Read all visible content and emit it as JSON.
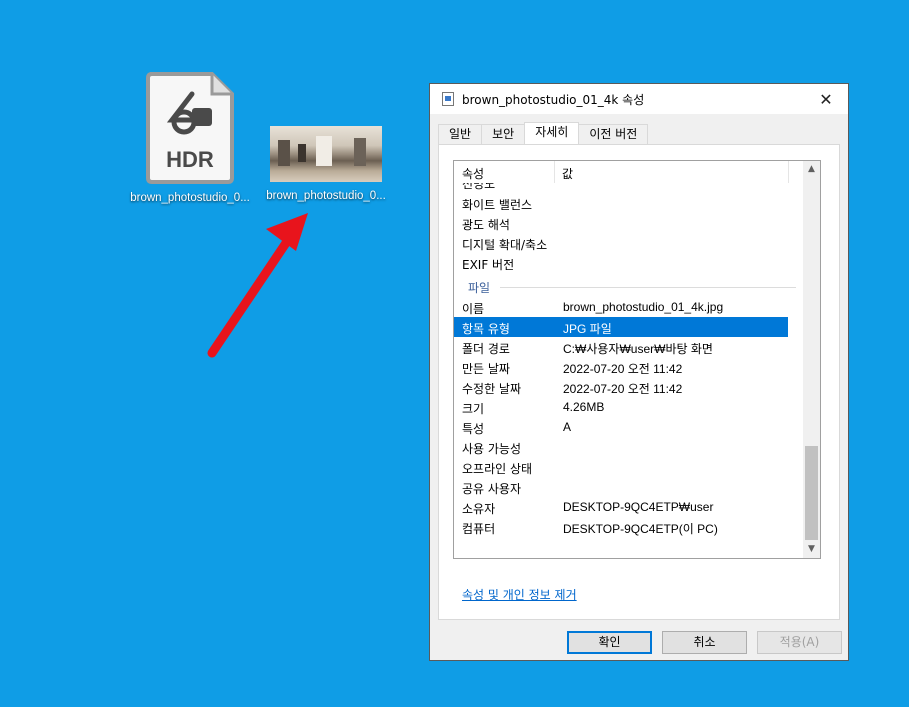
{
  "desktop": {
    "icons": [
      {
        "label": "brown_photostudio_0...",
        "badge": "HDR",
        "icon": "hdr-file-icon"
      },
      {
        "label": "brown_photostudio_0...",
        "icon": "jpg-thumbnail"
      }
    ],
    "accent_color": "#0f9de6",
    "arrow_color": "#e8141c"
  },
  "dialog": {
    "title": "brown_photostudio_01_4k 속성",
    "close_icon": "✕",
    "tabs": [
      "일반",
      "보안",
      "자세히",
      "이전 버전"
    ],
    "active_tab": "자세히",
    "columns": {
      "property": "속성",
      "value": "값"
    },
    "rows_top": [
      {
        "k": "선명도",
        "v": ""
      },
      {
        "k": "화이트 밸런스",
        "v": ""
      },
      {
        "k": "광도 해석",
        "v": ""
      },
      {
        "k": "디지털 확대/축소",
        "v": ""
      },
      {
        "k": "EXIF 버전",
        "v": ""
      }
    ],
    "group_label": "파일",
    "rows_file": [
      {
        "k": "이름",
        "v": "brown_photostudio_01_4k.jpg"
      },
      {
        "k": "항목 유형",
        "v": "JPG 파일"
      },
      {
        "k": "폴더 경로",
        "v": "C:₩사용자₩user₩바탕 화면"
      },
      {
        "k": "만든 날짜",
        "v": "2022-07-20 오전 11:42"
      },
      {
        "k": "수정한 날짜",
        "v": "2022-07-20 오전 11:42"
      },
      {
        "k": "크기",
        "v": "4.26MB"
      },
      {
        "k": "특성",
        "v": "A"
      },
      {
        "k": "사용 가능성",
        "v": ""
      },
      {
        "k": "오프라인 상태",
        "v": ""
      },
      {
        "k": "공유 사용자",
        "v": ""
      },
      {
        "k": "소유자",
        "v": "DESKTOP-9QC4ETP₩user"
      },
      {
        "k": "컴퓨터",
        "v": "DESKTOP-9QC4ETP(이 PC)"
      }
    ],
    "remove_link": "속성 및 개인 정보 제거",
    "buttons": {
      "ok": "확인",
      "cancel": "취소",
      "apply": "적용(A)"
    },
    "selection_color": "#0078d7"
  }
}
